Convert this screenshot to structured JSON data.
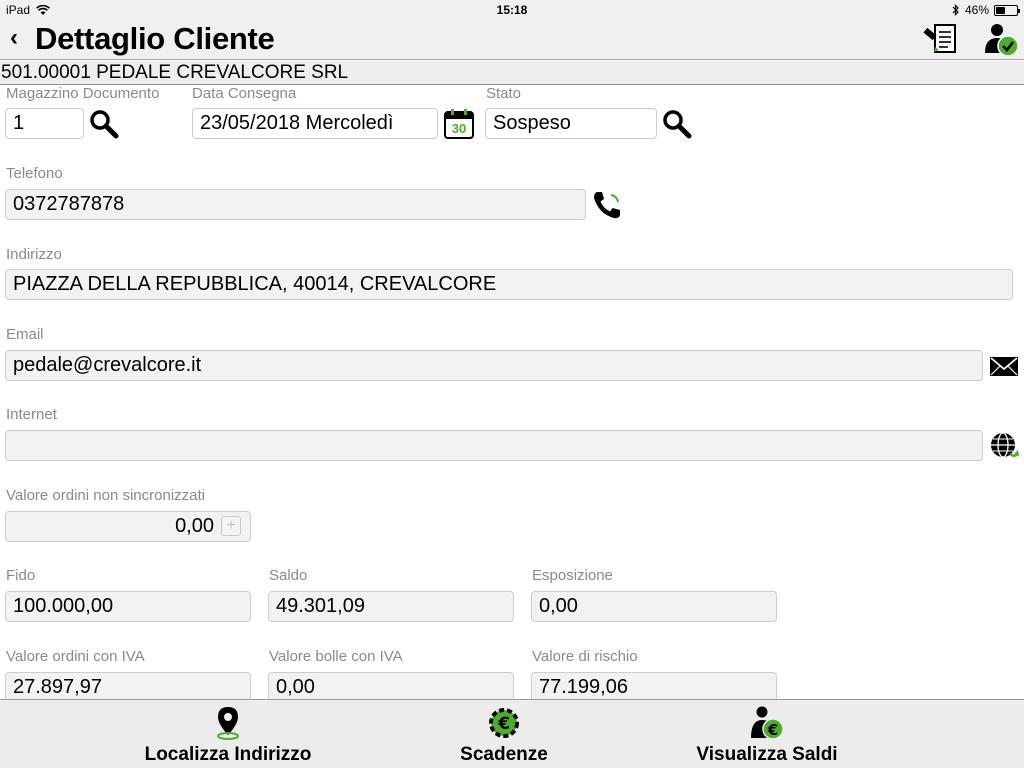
{
  "status_bar": {
    "device": "iPad",
    "time": "15:18",
    "battery": "46%",
    "battery_level": 0.46
  },
  "nav": {
    "back_label": "‹",
    "title": "Dettaglio Cliente"
  },
  "customer": {
    "code_name": "501.00001 PEDALE CREVALCORE SRL"
  },
  "fields": {
    "magazzino": {
      "label": "Magazzino Documento",
      "value": "1"
    },
    "data_consegna": {
      "label": "Data Consegna",
      "value": "23/05/2018  Mercoledì",
      "calendar_day": "30"
    },
    "stato": {
      "label": "Stato",
      "value": "Sospeso"
    },
    "telefono": {
      "label": "Telefono",
      "value": "0372787878"
    },
    "indirizzo": {
      "label": "Indirizzo",
      "value": "PIAZZA DELLA REPUBBLICA, 40014, CREVALCORE"
    },
    "email": {
      "label": "Email",
      "value": "pedale@crevalcore.it"
    },
    "internet": {
      "label": "Internet",
      "value": ""
    },
    "valore_non_sinc": {
      "label": "Valore ordini non sincronizzati",
      "value": "0,00",
      "plus": "+"
    },
    "fido": {
      "label": "Fido",
      "value": "100.000,00"
    },
    "saldo": {
      "label": "Saldo",
      "value": "49.301,09"
    },
    "esposizione": {
      "label": "Esposizione",
      "value": "0,00"
    },
    "ordini_iva": {
      "label": "Valore ordini con IVA",
      "value": "27.897,97"
    },
    "bolle_iva": {
      "label": "Valore bolle con IVA",
      "value": "0,00"
    },
    "rischio": {
      "label": "Valore di rischio",
      "value": "77.199,06"
    }
  },
  "tabs": [
    {
      "label": "Localizza Indirizzo",
      "icon": "map-pin-icon"
    },
    {
      "label": "Scadenze",
      "icon": "euro-gear-icon"
    },
    {
      "label": "Visualizza Saldi",
      "icon": "user-euro-icon"
    }
  ],
  "colors": {
    "accent_green": "#4caf2a",
    "bar_bg": "#f0f0f0"
  }
}
